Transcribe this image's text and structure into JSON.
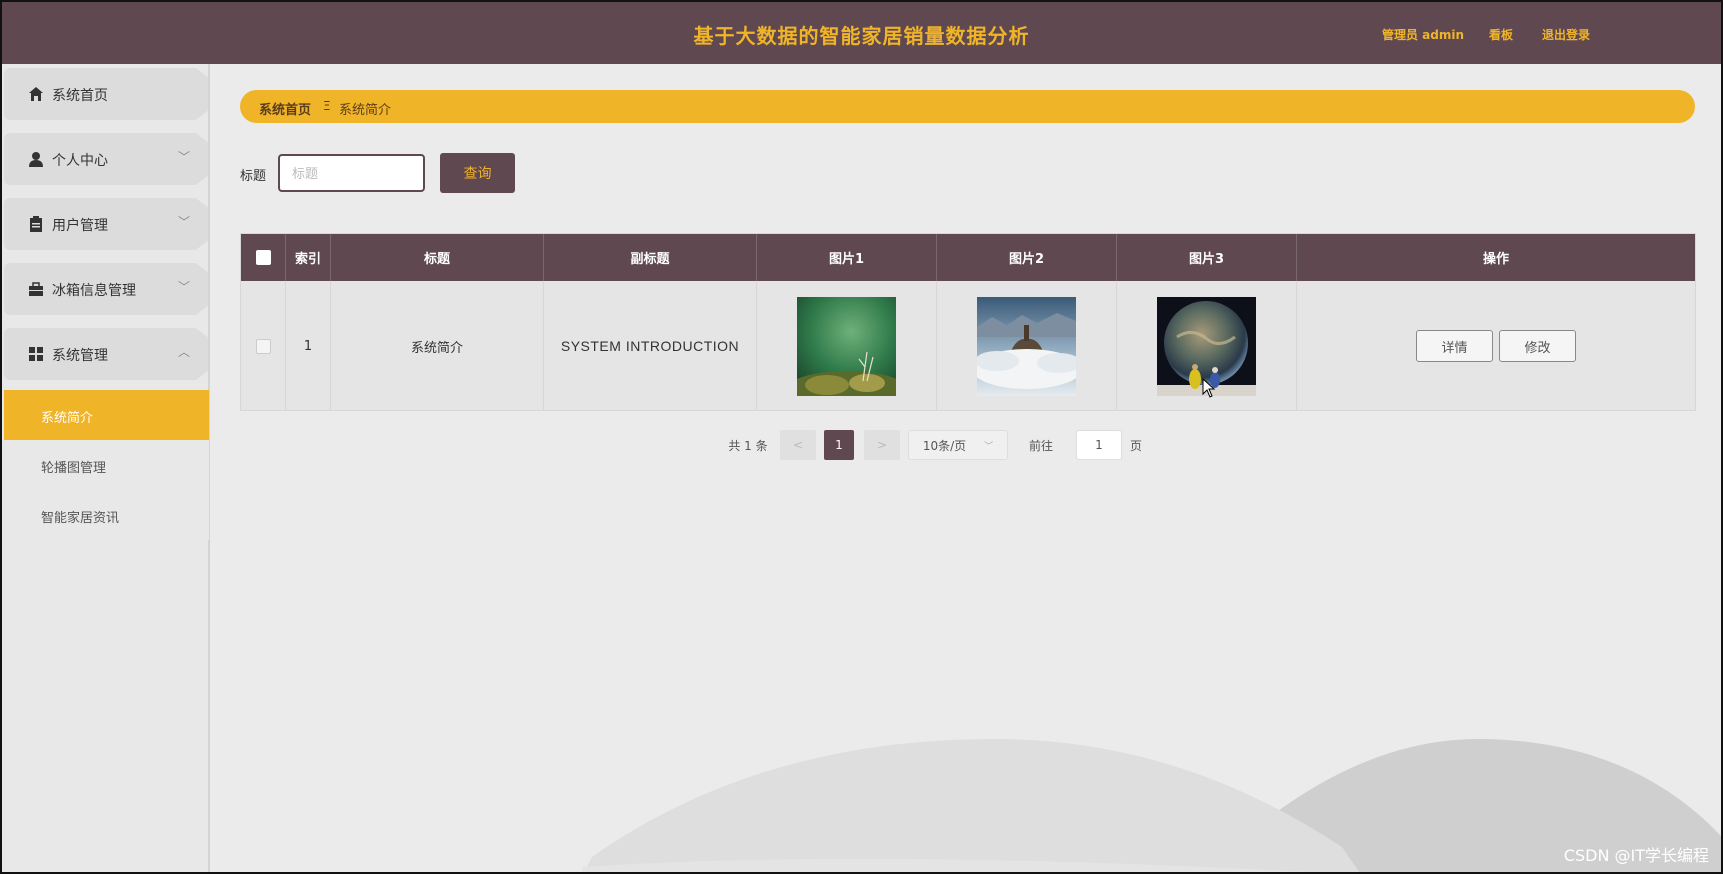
{
  "header": {
    "title": "基于大数据的智能家居销量数据分析",
    "admin": "管理员 admin",
    "board": "看板",
    "logout": "退出登录"
  },
  "sidebar": {
    "items": [
      {
        "label": "系统首页",
        "icon": "home-icon"
      },
      {
        "label": "个人中心",
        "icon": "user-icon"
      },
      {
        "label": "用户管理",
        "icon": "clipboard-icon"
      },
      {
        "label": "冰箱信息管理",
        "icon": "briefcase-icon"
      },
      {
        "label": "系统管理",
        "icon": "grid-icon"
      }
    ],
    "submenu": [
      {
        "label": "系统简介",
        "active": true
      },
      {
        "label": "轮播图管理",
        "active": false
      },
      {
        "label": "智能家居资讯",
        "active": false
      }
    ]
  },
  "breadcrumb": {
    "home": "系统首页",
    "separator": "Ξ",
    "current": "系统简介"
  },
  "search": {
    "label": "标题",
    "placeholder": "标题",
    "value": "",
    "button": "查询"
  },
  "table": {
    "headers": [
      "索引",
      "标题",
      "副标题",
      "图片1",
      "图片2",
      "图片3",
      "操作"
    ],
    "rows": [
      {
        "index": "1",
        "title": "系统简介",
        "subtitle": "SYSTEM INTRODUCTION",
        "image1": "green-moss-photo",
        "image2": "cloud-castle-photo",
        "image3": "planet-figures-photo",
        "detail": "详情",
        "edit": "修改"
      }
    ]
  },
  "pagination": {
    "total": "共 1 条",
    "prev": "<",
    "current_page": "1",
    "next": ">",
    "page_size": "10条/页",
    "goto_label": "前往",
    "goto_value": "1",
    "page_label": "页"
  },
  "watermark": "CSDN @IT学长编程",
  "colors": {
    "primary": "#5f4850",
    "accent": "#f0b429",
    "background": "#ebebeb"
  }
}
